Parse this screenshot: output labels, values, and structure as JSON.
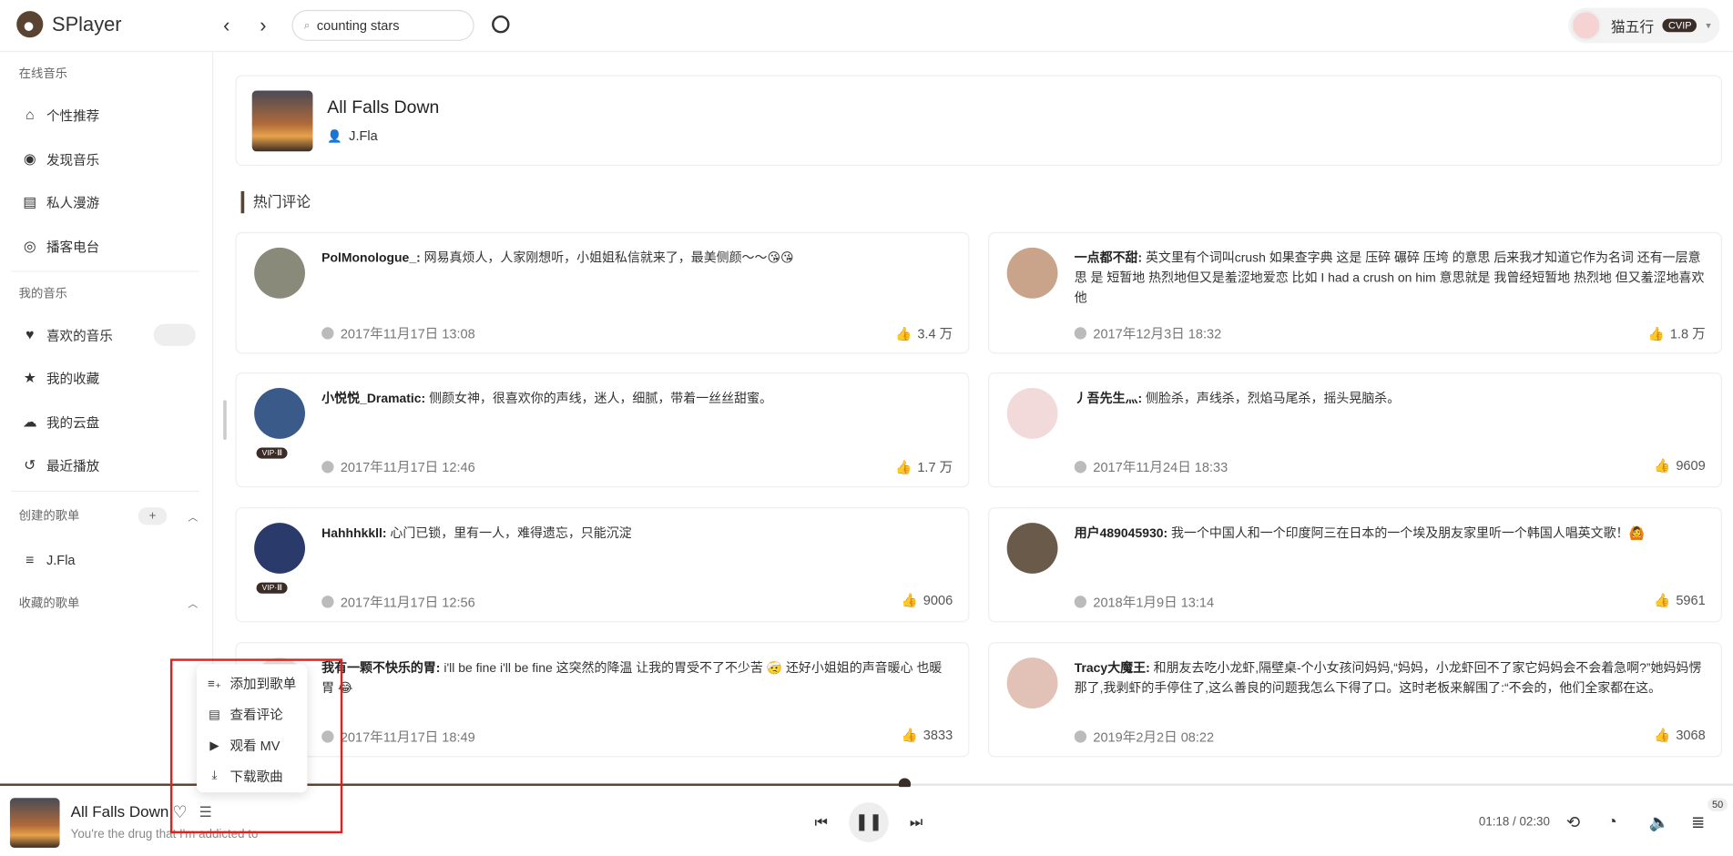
{
  "app": {
    "name": "SPlayer"
  },
  "header": {
    "back_icon": "chevron-left-icon",
    "forward_icon": "chevron-right-icon",
    "search_value": "counting stars",
    "user_name": "猫五行",
    "vip_label": "CVIP"
  },
  "sidebar": {
    "online_section": "在线音乐",
    "online_items": [
      {
        "label": "个性推荐",
        "icon": "home-icon"
      },
      {
        "label": "发现音乐",
        "icon": "compass-icon"
      },
      {
        "label": "私人漫游",
        "icon": "radio-icon"
      },
      {
        "label": "播客电台",
        "icon": "podcast-icon"
      }
    ],
    "my_section": "我的音乐",
    "my_items": [
      {
        "label": "喜欢的音乐",
        "icon": "heart-icon"
      },
      {
        "label": "我的收藏",
        "icon": "star-icon"
      },
      {
        "label": "我的云盘",
        "icon": "cloud-icon"
      },
      {
        "label": "最近播放",
        "icon": "history-icon"
      }
    ],
    "created_section": "创建的歌单",
    "created_playlists": [
      {
        "label": "J.Fla",
        "icon": "playlist-icon"
      }
    ],
    "collected_section": "收藏的歌单"
  },
  "song": {
    "title": "All Falls Down",
    "artist": "J.Fla"
  },
  "hot_comments_title": "热门评论",
  "comments": [
    {
      "user": "PolMonologue_:",
      "text": "网易真烦人，人家刚想听，小姐姐私信就来了，最美侧颜～～😘😘",
      "time": "2017年11月17日 13:08",
      "likes": "3.4 万",
      "vip": ""
    },
    {
      "user": "一点都不甜:",
      "text": "英文里有个词叫crush 如果查字典 这是 压碎 碾碎 压垮 的意思 后来我才知道它作为名词 还有一层意思 是 短暂地 热烈地但又是羞涩地爱恋 比如 I had a crush on him 意思就是 我曾经短暂地 热烈地 但又羞涩地喜欢他",
      "time": "2017年12月3日 18:32",
      "likes": "1.8 万",
      "vip": ""
    },
    {
      "user": "小悦悦_Dramatic:",
      "text": "侧颜女神，很喜欢你的声线，迷人，细腻，带着一丝丝甜蜜。",
      "time": "2017年11月17日 12:46",
      "likes": "1.7 万",
      "vip": "VIP·Ⅲ"
    },
    {
      "user": "丿吾先生灬:",
      "text": "侧脸杀，声线杀，烈焰马尾杀，摇头晃脑杀。",
      "time": "2017年11月24日 18:33",
      "likes": "9609",
      "vip": ""
    },
    {
      "user": "Hahhhkkll:",
      "text": "心门已锁，里有一人，难得遗忘，只能沉淀",
      "time": "2017年11月17日 12:56",
      "likes": "9006",
      "vip": "VIP·Ⅲ"
    },
    {
      "user": "用户489045930:",
      "text": "我一个中国人和一个印度阿三在日本的一个埃及朋友家里听一个韩国人唱英文歌！🙆",
      "time": "2018年1月9日 13:14",
      "likes": "5961",
      "vip": ""
    },
    {
      "user": "我有一颗不快乐的胃:",
      "text": "i'll be fine i'll be fine 这突然的降温 让我的胃受不了不少苦 🤕 还好小姐姐的声音暖心 也暖胃 😂",
      "time": "2017年11月17日 18:49",
      "likes": "3833",
      "vip": ""
    },
    {
      "user": "Tracy大魔王:",
      "text": "和朋友去吃小龙虾,隔壁桌-个小女孩问妈妈,“妈妈，小龙虾回不了家它妈妈会不会着急啊?”她妈妈愣那了,我剥虾的手停住了,这么善良的问题我怎么下得了口。这时老板来解围了:“不会的，他们全家都在这。",
      "time": "2019年2月2日 08:22",
      "likes": "3068",
      "vip": ""
    }
  ],
  "context_menu": [
    {
      "label": "添加到歌单",
      "icon": "playlist-add-icon"
    },
    {
      "label": "查看评论",
      "icon": "comment-icon"
    },
    {
      "label": "观看 MV",
      "icon": "video-icon"
    },
    {
      "label": "下载歌曲",
      "icon": "download-icon"
    }
  ],
  "player": {
    "title": "All Falls Down",
    "lyric": "You're the drug that I'm addicted to",
    "time": "01:18 / 02:30",
    "progress": 0.522,
    "queue_count": "50"
  }
}
